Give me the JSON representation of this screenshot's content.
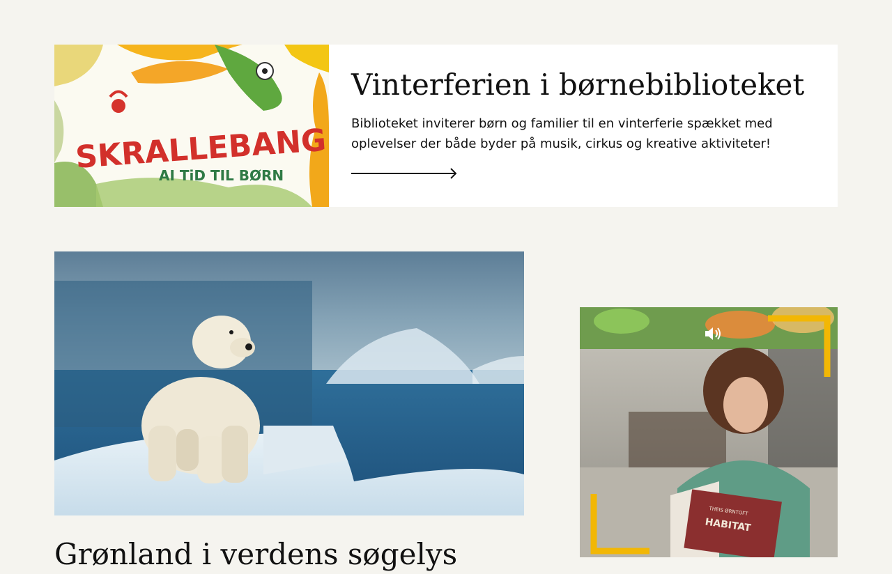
{
  "feature": {
    "title": "Vinterferien i børnebiblioteket",
    "text": "Biblioteket inviterer børn og familier til en vinterferie spækket med oplevelser der både byder på musik, cirkus og kreative aktiviteter!",
    "image_logo_text": "SKRALLEBANG!",
    "image_tagline": "AI TiD TIL BØRN"
  },
  "news": {
    "title": "Grønland i verdens søgelys"
  },
  "video": {
    "book_title": "HABITAT",
    "book_author": "THEIS ØRNTOFT",
    "sound_icon": "speaker-volume-icon"
  },
  "colors": {
    "background": "#f5f4ef",
    "card": "#ffffff",
    "accent_yellow": "#f2b705",
    "text": "#111111"
  }
}
